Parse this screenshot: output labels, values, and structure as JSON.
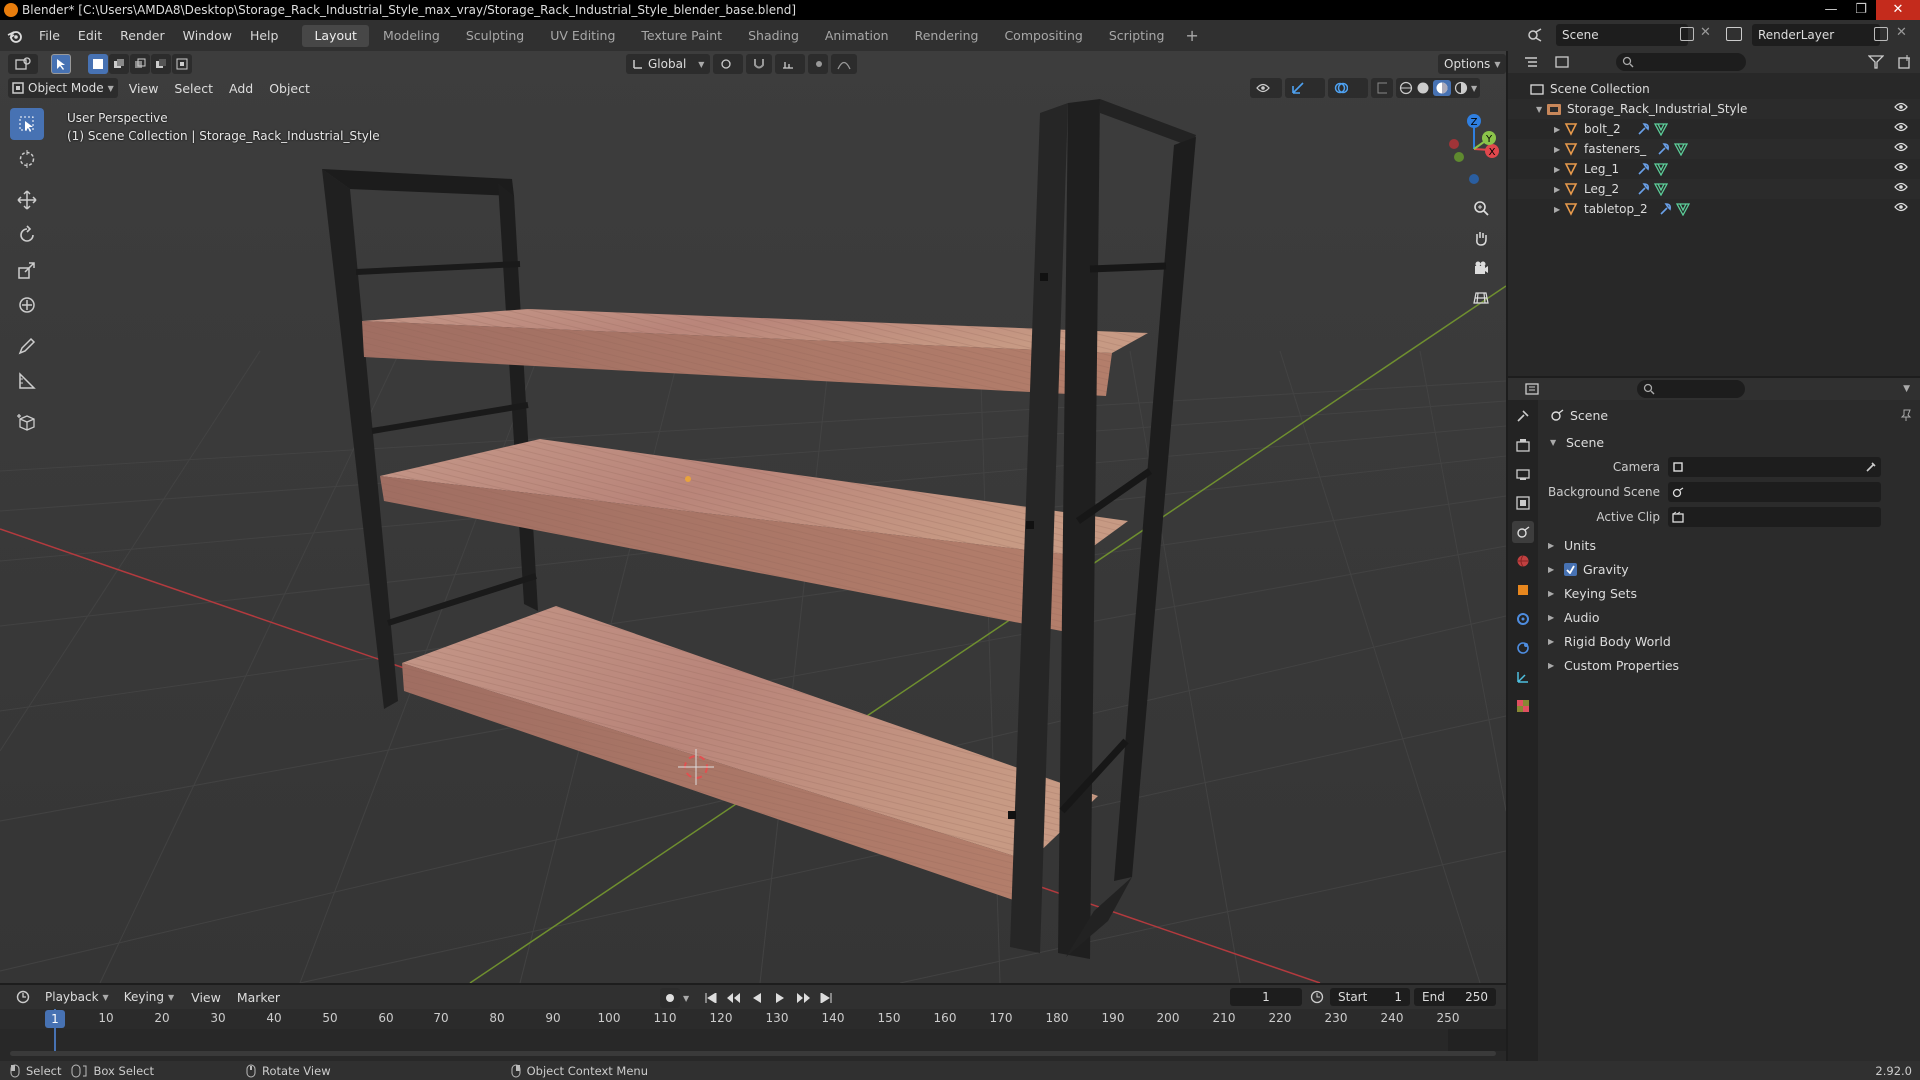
{
  "window": {
    "title": "Blender* [C:\\Users\\AMDA8\\Desktop\\Storage_Rack_Industrial_Style_max_vray/Storage_Rack_Industrial_Style_blender_base.blend]"
  },
  "menubar": {
    "items": [
      "File",
      "Edit",
      "Render",
      "Window",
      "Help"
    ],
    "workspaces": [
      "Layout",
      "Modeling",
      "Sculpting",
      "UV Editing",
      "Texture Paint",
      "Shading",
      "Animation",
      "Rendering",
      "Compositing",
      "Scripting"
    ],
    "active_workspace": "Layout",
    "add_workspace": "+",
    "scene": "Scene",
    "view_layer": "RenderLayer"
  },
  "viewport_header": {
    "transform_orientation": "Global",
    "options_label": "Options",
    "mode": "Object Mode",
    "menus": [
      "View",
      "Select",
      "Add",
      "Object"
    ]
  },
  "viewport": {
    "perspective": "User Perspective",
    "collection_info": "(1) Scene Collection | Storage_Rack_Industrial_Style",
    "axis_x": "X",
    "axis_y": "Y",
    "axis_z": "Z"
  },
  "outliner": {
    "root": "Scene Collection",
    "collection": "Storage_Rack_Industrial_Style",
    "objects": [
      "bolt_2",
      "fasteners_",
      "Leg_1",
      "Leg_2",
      "tabletop_2"
    ]
  },
  "properties": {
    "context": "Scene",
    "panel": "Scene",
    "fields": [
      {
        "label": "Camera",
        "value": ""
      },
      {
        "label": "Background Scene",
        "value": ""
      },
      {
        "label": "Active Clip",
        "value": ""
      }
    ],
    "subpanels": [
      "Units",
      "Gravity",
      "Keying Sets",
      "Audio",
      "Rigid Body World",
      "Custom Properties"
    ],
    "gravity_checked": true
  },
  "timeline": {
    "menus": [
      "Playback",
      "Keying",
      "View",
      "Marker"
    ],
    "current_frame": "1",
    "start_label": "Start",
    "start": "1",
    "end_label": "End",
    "end": "250",
    "ticks": [
      "1",
      "10",
      "20",
      "30",
      "40",
      "50",
      "60",
      "70",
      "80",
      "90",
      "100",
      "110",
      "120",
      "130",
      "140",
      "150",
      "160",
      "170",
      "180",
      "190",
      "200",
      "210",
      "220",
      "230",
      "240",
      "250"
    ]
  },
  "statusbar": {
    "select": "Select",
    "box_select": "Box Select",
    "rotate_view": "Rotate View",
    "context_menu": "Object Context Menu",
    "version": "2.92.0"
  },
  "colors": {
    "accent": "#4772b3",
    "blender_orange": "#e87d0d",
    "axis_x": "#e0474c",
    "axis_y": "#8bc34a",
    "axis_z": "#2f7fe0",
    "wood": "#b9857a",
    "metal": "#232323"
  }
}
